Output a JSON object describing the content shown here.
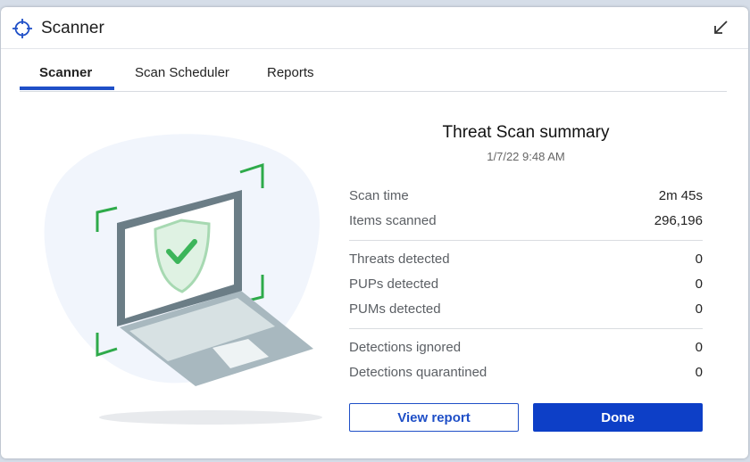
{
  "window": {
    "title": "Scanner"
  },
  "tabs": [
    {
      "label": "Scanner",
      "active": true
    },
    {
      "label": "Scan Scheduler",
      "active": false
    },
    {
      "label": "Reports",
      "active": false
    }
  ],
  "summary": {
    "title": "Threat Scan summary",
    "date": "1/7/22 9:48 AM",
    "rows": [
      {
        "label": "Scan time",
        "value": "2m 45s"
      },
      {
        "label": "Items scanned",
        "value": "296,196"
      },
      {
        "label": "Threats detected",
        "value": "0"
      },
      {
        "label": "PUPs detected",
        "value": "0"
      },
      {
        "label": "PUMs detected",
        "value": "0"
      },
      {
        "label": "Detections ignored",
        "value": "0"
      },
      {
        "label": "Detections quarantined",
        "value": "0"
      }
    ]
  },
  "buttons": {
    "view_report": "View report",
    "done": "Done"
  },
  "icons": {
    "title": "crosshair-icon",
    "restore": "restore-down-arrow-icon",
    "illustration": "laptop-shield-check-icon"
  },
  "colors": {
    "accent": "#0d3fc7",
    "check_green": "#3cb55a",
    "frame_green": "#2eaa4a"
  }
}
